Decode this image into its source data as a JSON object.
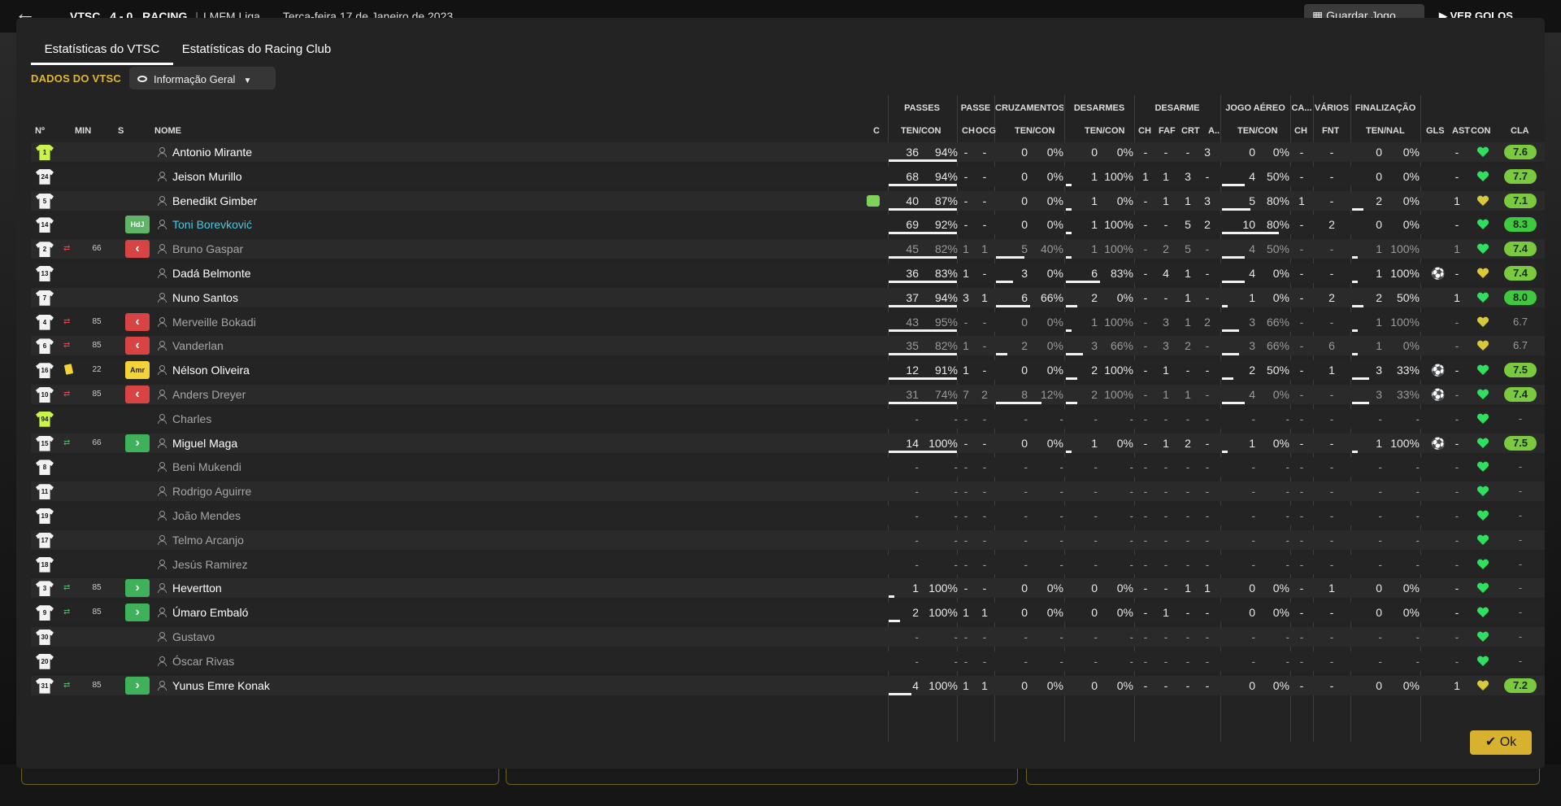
{
  "topbar": {
    "home_team": "VTSC",
    "score": "4 - 0",
    "away_team": "RACING",
    "competition": "I MFM Liga",
    "date": "Terça-feira 17 de Janeiro de 2023",
    "save_label": "Guardar Jogo",
    "goals_label": "VER GOLOS"
  },
  "tabs": [
    {
      "label": "Estatísticas do VTSC",
      "active": true
    },
    {
      "label": "Estatísticas do Racing Club",
      "active": false
    }
  ],
  "section_label": "DADOS DO VTSC",
  "view_dropdown": "Informação Geral",
  "groups": {
    "passes": "PASSES",
    "passe": "PASSE",
    "cruzamentos": "CRUZAMENTOS",
    "desarmes": "DESARMES",
    "desarme": "DESARME",
    "jogo_aereo": "JOGO AÉREO",
    "ca": "CA...",
    "varios": "VÁRIOS",
    "finalizacao": "FINALIZAÇÃO"
  },
  "columns": {
    "num": "Nº",
    "min": "MIN",
    "s": "S",
    "nome": "NOME",
    "c": "C",
    "pass_tc": "TEN/CON",
    "pass_ch": "CH",
    "pass_ocg": "OCG",
    "cruz_tc": "TEN/CON",
    "des_tc": "TEN/CON",
    "d_ch": "CH",
    "d_faf": "FAF",
    "d_crt": "CRT",
    "d_a": "A...",
    "aer_tc": "TEN/CON",
    "ca_ch": "CH",
    "var_fnt": "FNT",
    "fin_tn": "TEN/NAL",
    "gls": "GLS",
    "ast": "AST",
    "con": "CON",
    "cla": "CLA"
  },
  "rows": [
    {
      "num": "1",
      "gk": true,
      "name": "Antonio Mirante",
      "dim": false,
      "pt": "36",
      "pp": "94%",
      "ch": "-",
      "ocg": "-",
      "ct": "0",
      "cp": "0%",
      "dt": "0",
      "dp": "0%",
      "dch": "-",
      "faf": "-",
      "crt": "-",
      "da": "3",
      "at": "0",
      "ap": "0%",
      "cach": "-",
      "fnt": "-",
      "ft": "0",
      "fp": "0%",
      "gls": "",
      "ast": "-",
      "rating": "7.6"
    },
    {
      "num": "24",
      "name": "Jeison Murillo",
      "dim": false,
      "pt": "68",
      "pp": "94%",
      "ch": "-",
      "ocg": "-",
      "ct": "0",
      "cp": "0%",
      "dt": "1",
      "dp": "100%",
      "dch": "1",
      "faf": "1",
      "crt": "3",
      "da": "-",
      "at": "4",
      "ap": "50%",
      "cach": "-",
      "fnt": "-",
      "ft": "0",
      "fp": "0%",
      "gls": "",
      "ast": "-",
      "rating": "7.7"
    },
    {
      "num": "5",
      "name": "Benedikt Gimber",
      "dim": false,
      "captain": true,
      "pt": "40",
      "pp": "87%",
      "ch": "-",
      "ocg": "-",
      "ct": "0",
      "cp": "0%",
      "dt": "1",
      "dp": "0%",
      "dch": "-",
      "faf": "1",
      "crt": "1",
      "da": "3",
      "at": "5",
      "ap": "80%",
      "cach": "1",
      "fnt": "-",
      "ft": "2",
      "fp": "0%",
      "gls": "",
      "ast": "1",
      "rating": "7.1"
    },
    {
      "num": "14",
      "role": "HdJ",
      "name": "Toni Borevković",
      "dim": false,
      "hl": true,
      "pt": "69",
      "pp": "92%",
      "ch": "-",
      "ocg": "-",
      "ct": "0",
      "cp": "0%",
      "dt": "1",
      "dp": "100%",
      "dch": "-",
      "faf": "-",
      "crt": "5",
      "da": "2",
      "at": "10",
      "ap": "80%",
      "cach": "-",
      "fnt": "2",
      "ft": "0",
      "fp": "0%",
      "gls": "",
      "ast": "-",
      "rating": "8.3"
    },
    {
      "num": "2",
      "sub": "out",
      "min": "66",
      "name": "Bruno Gaspar",
      "dim": true,
      "pt": "45",
      "pp": "82%",
      "ch": "1",
      "ocg": "1",
      "ct": "5",
      "cp": "40%",
      "dt": "1",
      "dp": "100%",
      "dch": "-",
      "faf": "2",
      "crt": "5",
      "da": "-",
      "at": "4",
      "ap": "50%",
      "cach": "-",
      "fnt": "-",
      "ft": "1",
      "fp": "100%",
      "gls": "",
      "ast": "1",
      "rating": "7.4"
    },
    {
      "num": "13",
      "name": "Dadá Belmonte",
      "dim": false,
      "pt": "36",
      "pp": "83%",
      "ch": "1",
      "ocg": "-",
      "ct": "3",
      "cp": "0%",
      "dt": "6",
      "dp": "83%",
      "dch": "-",
      "faf": "4",
      "crt": "1",
      "da": "-",
      "at": "4",
      "ap": "0%",
      "cach": "-",
      "fnt": "-",
      "ft": "1",
      "fp": "100%",
      "gls": "ball",
      "ast": "-",
      "rating": "7.4"
    },
    {
      "num": "7",
      "name": "Nuno Santos",
      "dim": false,
      "pt": "37",
      "pp": "94%",
      "ch": "3",
      "ocg": "1",
      "ct": "6",
      "cp": "66%",
      "dt": "2",
      "dp": "0%",
      "dch": "-",
      "faf": "-",
      "crt": "1",
      "da": "-",
      "at": "1",
      "ap": "0%",
      "cach": "-",
      "fnt": "2",
      "ft": "2",
      "fp": "50%",
      "gls": "",
      "ast": "1",
      "rating": "8.0"
    },
    {
      "num": "4",
      "sub": "out",
      "min": "85",
      "name": "Merveille Bokadi",
      "dim": true,
      "pt": "43",
      "pp": "95%",
      "ch": "-",
      "ocg": "-",
      "ct": "0",
      "cp": "0%",
      "dt": "1",
      "dp": "100%",
      "dch": "-",
      "faf": "3",
      "crt": "1",
      "da": "2",
      "at": "3",
      "ap": "66%",
      "cach": "-",
      "fnt": "-",
      "ft": "1",
      "fp": "100%",
      "gls": "",
      "ast": "-",
      "rating": "6.7",
      "nr": true
    },
    {
      "num": "6",
      "sub": "out",
      "min": "85",
      "name": "Vanderlan",
      "dim": true,
      "pt": "35",
      "pp": "82%",
      "ch": "1",
      "ocg": "-",
      "ct": "2",
      "cp": "0%",
      "dt": "3",
      "dp": "66%",
      "dch": "-",
      "faf": "3",
      "crt": "2",
      "da": "-",
      "at": "3",
      "ap": "66%",
      "cach": "-",
      "fnt": "6",
      "ft": "1",
      "fp": "0%",
      "gls": "",
      "ast": "-",
      "rating": "6.7",
      "nr": true
    },
    {
      "num": "16",
      "yc": true,
      "min": "22",
      "role": "Amr",
      "name": "Nélson Oliveira",
      "dim": false,
      "pt": "12",
      "pp": "91%",
      "ch": "1",
      "ocg": "-",
      "ct": "0",
      "cp": "0%",
      "dt": "2",
      "dp": "100%",
      "dch": "-",
      "faf": "1",
      "crt": "-",
      "da": "-",
      "at": "2",
      "ap": "50%",
      "cach": "-",
      "fnt": "1",
      "ft": "3",
      "fp": "33%",
      "gls": "ball",
      "ast": "-",
      "rating": "7.5"
    },
    {
      "num": "10",
      "sub": "out",
      "min": "85",
      "name": "Anders Dreyer",
      "dim": true,
      "pt": "31",
      "pp": "74%",
      "ch": "7",
      "ocg": "2",
      "ct": "8",
      "cp": "12%",
      "dt": "2",
      "dp": "100%",
      "dch": "-",
      "faf": "1",
      "crt": "1",
      "da": "-",
      "at": "4",
      "ap": "0%",
      "cach": "-",
      "fnt": "-",
      "ft": "3",
      "fp": "33%",
      "gls": "ball",
      "ast": "-",
      "rating": "7.4"
    },
    {
      "num": "94",
      "gk": true,
      "name": "Charles",
      "dim": true,
      "pt": "-",
      "pp": "-",
      "ch": "-",
      "ocg": "-",
      "ct": "-",
      "cp": "-",
      "dt": "-",
      "dp": "-",
      "dch": "-",
      "faf": "-",
      "crt": "-",
      "da": "-",
      "at": "-",
      "ap": "-",
      "cach": "-",
      "fnt": "-",
      "ft": "-",
      "fp": "-",
      "gls": "",
      "ast": "-",
      "rating": "-"
    },
    {
      "num": "15",
      "sub": "in",
      "min": "66",
      "name": "Miguel Maga",
      "dim": false,
      "pt": "14",
      "pp": "100%",
      "ch": "-",
      "ocg": "-",
      "ct": "0",
      "cp": "0%",
      "dt": "1",
      "dp": "0%",
      "dch": "-",
      "faf": "1",
      "crt": "2",
      "da": "-",
      "at": "1",
      "ap": "0%",
      "cach": "-",
      "fnt": "-",
      "ft": "1",
      "fp": "100%",
      "gls": "ball",
      "ast": "-",
      "rating": "7.5"
    },
    {
      "num": "8",
      "name": "Beni Mukendi",
      "dim": true,
      "pt": "-",
      "pp": "-",
      "ch": "-",
      "ocg": "-",
      "ct": "-",
      "cp": "-",
      "dt": "-",
      "dp": "-",
      "dch": "-",
      "faf": "-",
      "crt": "-",
      "da": "-",
      "at": "-",
      "ap": "-",
      "cach": "-",
      "fnt": "-",
      "ft": "-",
      "fp": "-",
      "gls": "",
      "ast": "-",
      "rating": "-"
    },
    {
      "num": "11",
      "name": "Rodrigo Aguirre",
      "dim": true,
      "pt": "-",
      "pp": "-",
      "ch": "-",
      "ocg": "-",
      "ct": "-",
      "cp": "-",
      "dt": "-",
      "dp": "-",
      "dch": "-",
      "faf": "-",
      "crt": "-",
      "da": "-",
      "at": "-",
      "ap": "-",
      "cach": "-",
      "fnt": "-",
      "ft": "-",
      "fp": "-",
      "gls": "",
      "ast": "-",
      "rating": "-"
    },
    {
      "num": "19",
      "name": "João Mendes",
      "dim": true,
      "pt": "-",
      "pp": "-",
      "ch": "-",
      "ocg": "-",
      "ct": "-",
      "cp": "-",
      "dt": "-",
      "dp": "-",
      "dch": "-",
      "faf": "-",
      "crt": "-",
      "da": "-",
      "at": "-",
      "ap": "-",
      "cach": "-",
      "fnt": "-",
      "ft": "-",
      "fp": "-",
      "gls": "",
      "ast": "-",
      "rating": "-"
    },
    {
      "num": "17",
      "name": "Telmo Arcanjo",
      "dim": true,
      "pt": "-",
      "pp": "-",
      "ch": "-",
      "ocg": "-",
      "ct": "-",
      "cp": "-",
      "dt": "-",
      "dp": "-",
      "dch": "-",
      "faf": "-",
      "crt": "-",
      "da": "-",
      "at": "-",
      "ap": "-",
      "cach": "-",
      "fnt": "-",
      "ft": "-",
      "fp": "-",
      "gls": "",
      "ast": "-",
      "rating": "-"
    },
    {
      "num": "18",
      "name": "Jesús Ramirez",
      "dim": true,
      "pt": "-",
      "pp": "-",
      "ch": "-",
      "ocg": "-",
      "ct": "-",
      "cp": "-",
      "dt": "-",
      "dp": "-",
      "dch": "-",
      "faf": "-",
      "crt": "-",
      "da": "-",
      "at": "-",
      "ap": "-",
      "cach": "-",
      "fnt": "-",
      "ft": "-",
      "fp": "-",
      "gls": "",
      "ast": "-",
      "rating": "-"
    },
    {
      "num": "3",
      "sub": "in",
      "min": "85",
      "name": "Hevertton",
      "dim": false,
      "pt": "1",
      "pp": "100%",
      "ch": "-",
      "ocg": "-",
      "ct": "0",
      "cp": "0%",
      "dt": "0",
      "dp": "0%",
      "dch": "-",
      "faf": "-",
      "crt": "1",
      "da": "1",
      "at": "0",
      "ap": "0%",
      "cach": "-",
      "fnt": "1",
      "ft": "0",
      "fp": "0%",
      "gls": "",
      "ast": "-",
      "rating": "-"
    },
    {
      "num": "9",
      "sub": "in",
      "min": "85",
      "name": "Úmaro Embaló",
      "dim": false,
      "pt": "2",
      "pp": "100%",
      "ch": "1",
      "ocg": "1",
      "ct": "0",
      "cp": "0%",
      "dt": "0",
      "dp": "0%",
      "dch": "-",
      "faf": "1",
      "crt": "-",
      "da": "-",
      "at": "0",
      "ap": "0%",
      "cach": "-",
      "fnt": "-",
      "ft": "0",
      "fp": "0%",
      "gls": "",
      "ast": "-",
      "rating": "-"
    },
    {
      "num": "30",
      "name": "Gustavo",
      "dim": true,
      "pt": "-",
      "pp": "-",
      "ch": "-",
      "ocg": "-",
      "ct": "-",
      "cp": "-",
      "dt": "-",
      "dp": "-",
      "dch": "-",
      "faf": "-",
      "crt": "-",
      "da": "-",
      "at": "-",
      "ap": "-",
      "cach": "-",
      "fnt": "-",
      "ft": "-",
      "fp": "-",
      "gls": "",
      "ast": "-",
      "rating": "-"
    },
    {
      "num": "20",
      "name": "Óscar Rivas",
      "dim": true,
      "pt": "-",
      "pp": "-",
      "ch": "-",
      "ocg": "-",
      "ct": "-",
      "cp": "-",
      "dt": "-",
      "dp": "-",
      "dch": "-",
      "faf": "-",
      "crt": "-",
      "da": "-",
      "at": "-",
      "ap": "-",
      "cach": "-",
      "fnt": "-",
      "ft": "-",
      "fp": "-",
      "gls": "",
      "ast": "-",
      "rating": "-"
    },
    {
      "num": "31",
      "sub": "in",
      "min": "85",
      "name": "Yunus Emre Konak",
      "dim": false,
      "pt": "4",
      "pp": "100%",
      "ch": "1",
      "ocg": "1",
      "ct": "0",
      "cp": "0%",
      "dt": "0",
      "dp": "0%",
      "dch": "-",
      "faf": "-",
      "crt": "-",
      "da": "-",
      "at": "0",
      "ap": "0%",
      "cach": "-",
      "fnt": "-",
      "ft": "0",
      "fp": "0%",
      "gls": "",
      "ast": "1",
      "rating": "7.2"
    }
  ],
  "colors": {
    "rating_high": "#3fc93f",
    "rating_mid": "#7ac93f",
    "heart_green": "#2fe060",
    "heart_yellow": "#d8c83a",
    "accent_gold": "#e0b830"
  },
  "ok_label": "Ok"
}
